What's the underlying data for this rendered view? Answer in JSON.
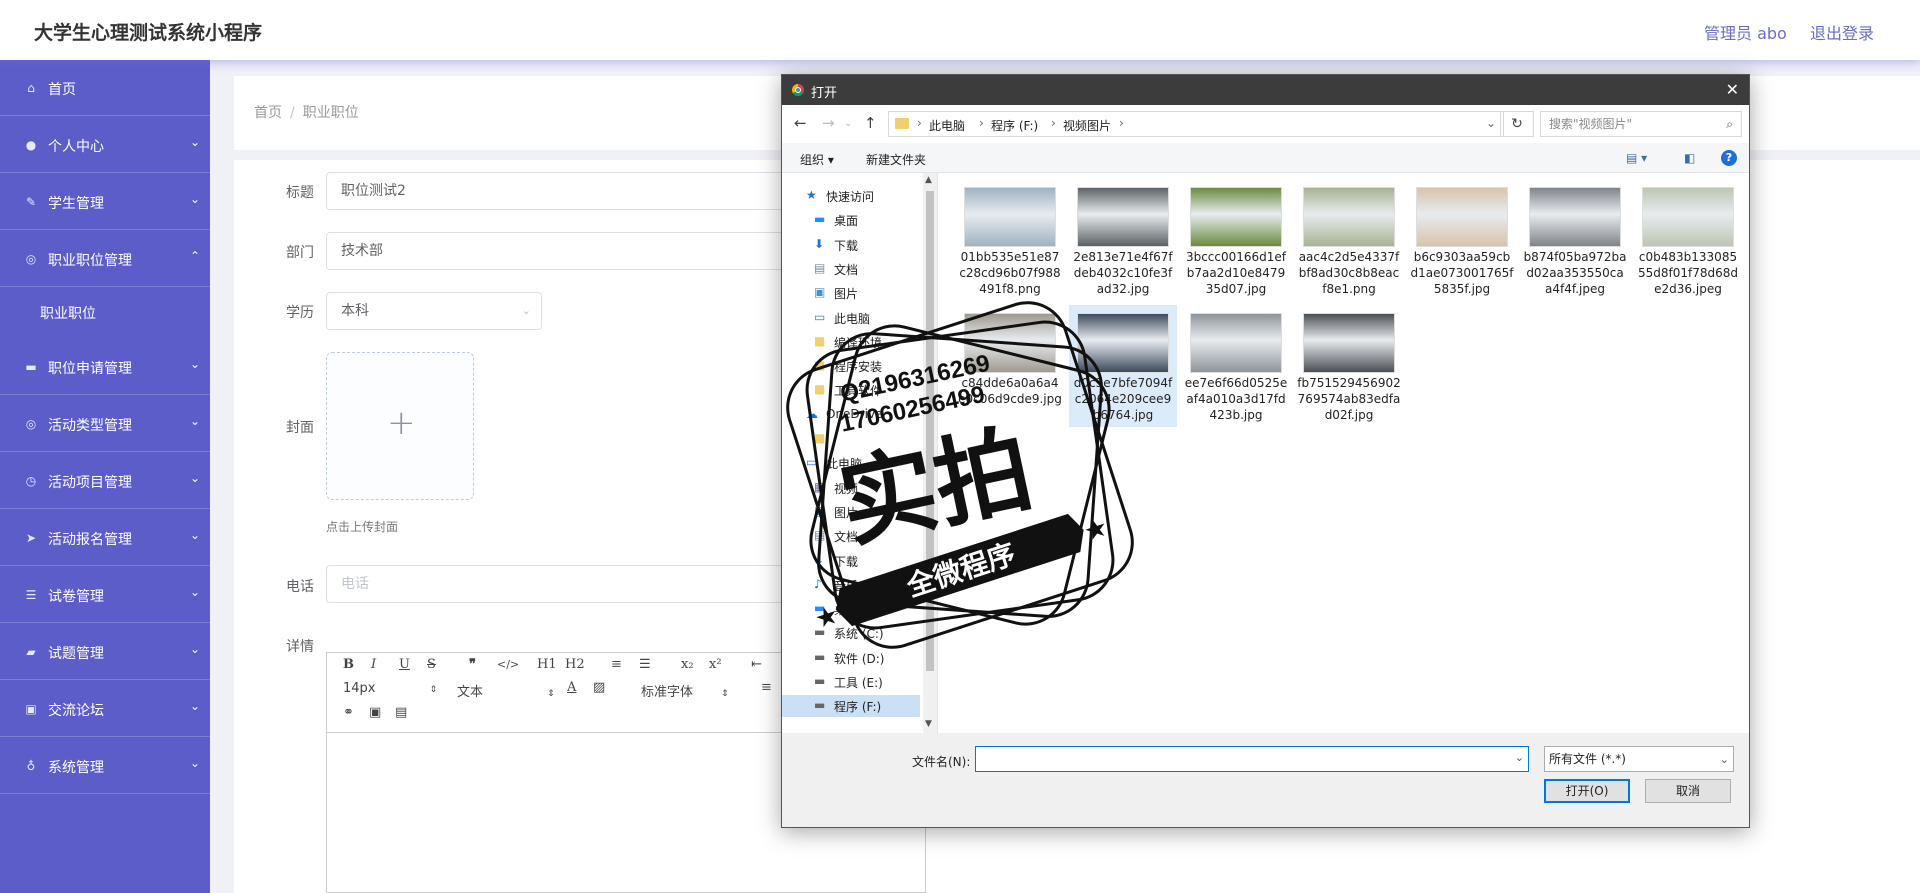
{
  "app": {
    "title": "大学生心理测试系统小程序",
    "admin_label": "管理员 abo",
    "logout_label": "退出登录"
  },
  "sidebar": {
    "items": [
      {
        "label": "首页",
        "icon": "home-icon"
      },
      {
        "label": "个人中心",
        "icon": "user-icon"
      },
      {
        "label": "学生管理",
        "icon": "student-icon"
      },
      {
        "label": "职业职位管理",
        "icon": "compass-icon",
        "expanded": true
      },
      {
        "label": "职位申请管理",
        "icon": "monitor-icon"
      },
      {
        "label": "活动类型管理",
        "icon": "compass-icon"
      },
      {
        "label": "活动项目管理",
        "icon": "clock-icon"
      },
      {
        "label": "活动报名管理",
        "icon": "send-icon"
      },
      {
        "label": "试卷管理",
        "icon": "list-icon"
      },
      {
        "label": "试题管理",
        "icon": "thumb-icon"
      },
      {
        "label": "交流论坛",
        "icon": "badge-icon"
      },
      {
        "label": "系统管理",
        "icon": "mic-icon"
      }
    ],
    "subitem": "职业职位"
  },
  "breadcrumb": {
    "home": "首页",
    "sep": "/",
    "current": "职业职位"
  },
  "form": {
    "title_label": "标题",
    "title_value": "职位测试2",
    "dept_label": "部门",
    "dept_value": "技术部",
    "edu_label": "学历",
    "edu_value": "本科",
    "cover_label": "封面",
    "cover_tip": "点击上传封面",
    "phone_label": "电话",
    "phone_placeholder": "电话",
    "detail_label": "详情"
  },
  "editor": {
    "toolbar_row1": [
      "B",
      "I",
      "U",
      "S",
      "❞",
      "</>",
      "H1",
      "H2",
      "≡",
      "☰",
      "x₂",
      "x²",
      "⇤"
    ],
    "font_size": "14px",
    "block_type": "文本",
    "font_family": "标准字体"
  },
  "dialog": {
    "title": "打开",
    "close": "✕",
    "path": [
      "此电脑",
      "程序 (F:)",
      "视频图片"
    ],
    "search_placeholder": "搜索\"视频图片\"",
    "cmd_organize": "组织 ▾",
    "cmd_new_folder": "新建文件夹",
    "nav_tree": [
      {
        "label": "快速访问",
        "icon": "star-icon",
        "indent": 0
      },
      {
        "label": "桌面",
        "icon": "desktop-icon",
        "indent": 1
      },
      {
        "label": "下载",
        "icon": "download-icon",
        "indent": 1
      },
      {
        "label": "文档",
        "icon": "document-icon",
        "indent": 1
      },
      {
        "label": "图片",
        "icon": "picture-icon",
        "indent": 1
      },
      {
        "label": "此电脑",
        "icon": "pc-icon",
        "indent": 1
      },
      {
        "label": "编译环境",
        "icon": "folder-icon",
        "indent": 1
      },
      {
        "label": "程序安装",
        "icon": "folder-icon",
        "indent": 1
      },
      {
        "label": "工具软件",
        "icon": "folder-icon",
        "indent": 1
      },
      {
        "label": "OneDrive",
        "icon": "cloud-icon",
        "indent": 0
      },
      {
        "label": "",
        "icon": "folder-icon",
        "indent": 1
      },
      {
        "label": "此电脑",
        "icon": "pc-icon",
        "indent": 0
      },
      {
        "label": "视频",
        "icon": "video-icon",
        "indent": 1
      },
      {
        "label": "图片",
        "icon": "picture-icon",
        "indent": 1
      },
      {
        "label": "文档",
        "icon": "document-icon",
        "indent": 1
      },
      {
        "label": "下载",
        "icon": "download-icon",
        "indent": 1
      },
      {
        "label": "音乐",
        "icon": "music-icon",
        "indent": 1
      },
      {
        "label": "桌面",
        "icon": "desktop-icon",
        "indent": 1
      },
      {
        "label": "系统 (C:)",
        "icon": "drive-icon",
        "indent": 1
      },
      {
        "label": "软件 (D:)",
        "icon": "drive-icon",
        "indent": 1
      },
      {
        "label": "工具 (E:)",
        "icon": "drive-icon",
        "indent": 1
      },
      {
        "label": "程序 (F:)",
        "icon": "drive-icon",
        "indent": 1,
        "selected": true
      }
    ],
    "files": [
      {
        "name": "01bb535e51e87c28cd96b07f988491f8.png",
        "color": "#9fb2c2"
      },
      {
        "name": "2e813e71e4f67fdeb4032c10fe3fad32.jpg",
        "color": "#5b6266"
      },
      {
        "name": "3bccc00166d1efb7aa2d10e847935d07.jpg",
        "color": "#6b8a3f"
      },
      {
        "name": "aac4c2d5e4337fbf8ad30c8b8eacf8e1.png",
        "color": "#a7b394"
      },
      {
        "name": "b6c9303aa59cbd1ae073001765f5835f.jpg",
        "color": "#d8c3ad"
      },
      {
        "name": "b874f05ba972bad02aa353550caa4f4f.jpeg",
        "color": "#7f848a"
      },
      {
        "name": "c0b483b13308555d8f01f78d68de2d36.jpeg",
        "color": "#bcc6b3"
      },
      {
        "name": "c84dde6a0a6a4e0c06d9cde9.jpg",
        "color": "#a09a8f"
      },
      {
        "name": "d0c3e7bfe7094fc2064e209cee9b6764.jpg",
        "color": "#3e4a5c",
        "selected": true
      },
      {
        "name": "ee7e6f66d0525eaf4a010a3d17fd423b.jpg",
        "color": "#8d949a"
      },
      {
        "name": "fb751529456902769574ab83edfad02f.jpg",
        "color": "#4b5056"
      }
    ],
    "filename_label": "文件名(N):",
    "filetype_value": "所有文件 (*.*)",
    "open_label": "打开(O)",
    "cancel_label": "取消"
  },
  "watermark": {
    "line1": "Q2196316269",
    "line2": "17060256499",
    "main": "实拍",
    "banner": "全微程序"
  }
}
